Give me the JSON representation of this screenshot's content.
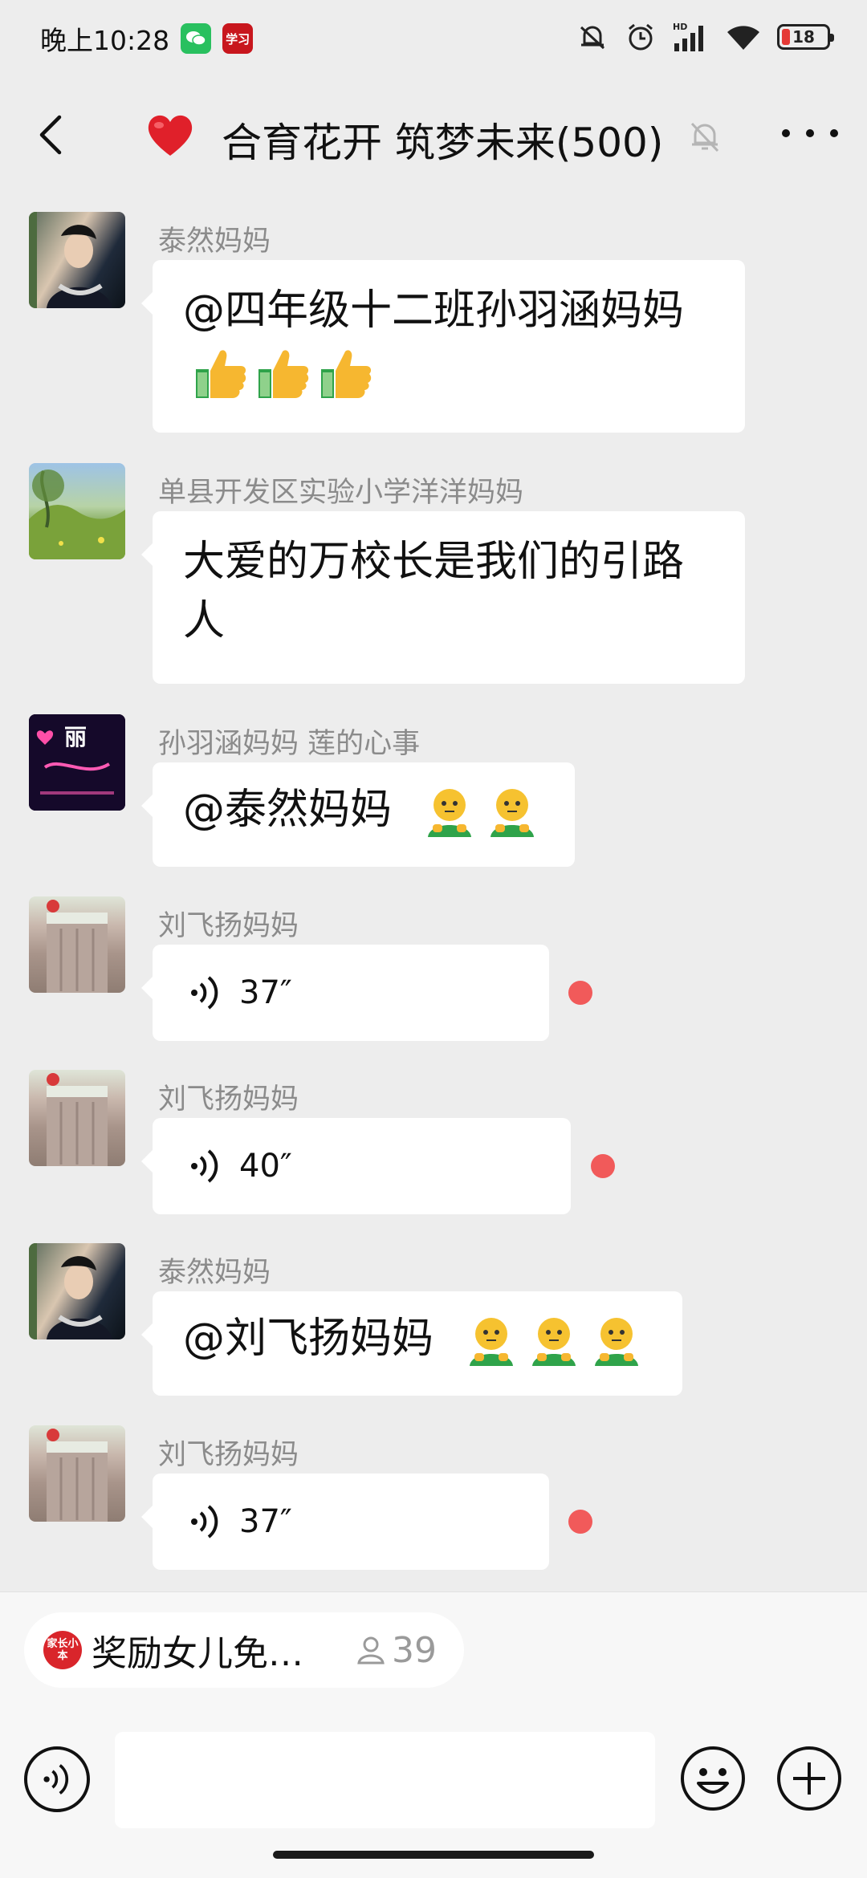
{
  "status_bar": {
    "time": "晚上10:28",
    "app_badge": "学习",
    "battery": "18"
  },
  "header": {
    "title": "合育花开 筑梦未来(500)"
  },
  "messages": [
    {
      "sender": "泰然妈妈",
      "text": "@四年级十二班孙羽涵妈妈"
    },
    {
      "sender": "单县开发区实验小学洋洋妈妈",
      "text_line1": "大爱的万校长是我们的引路",
      "text_line2": "人"
    },
    {
      "sender": "孙羽涵妈妈 莲的心事",
      "text": "@泰然妈妈",
      "avatar_text": "丽"
    },
    {
      "sender": "刘飞扬妈妈",
      "voice": "37″"
    },
    {
      "sender": "刘飞扬妈妈",
      "voice": "40″"
    },
    {
      "sender": "泰然妈妈",
      "text": "@刘飞扬妈妈"
    },
    {
      "sender": "刘飞扬妈妈",
      "voice": "37″"
    }
  ],
  "live": {
    "logo": "家长小本",
    "title": "奖励女儿免…",
    "count": "39"
  },
  "colors": {
    "unread": "#f15a5a",
    "background": "#ededed",
    "heart": "#e0202a"
  }
}
